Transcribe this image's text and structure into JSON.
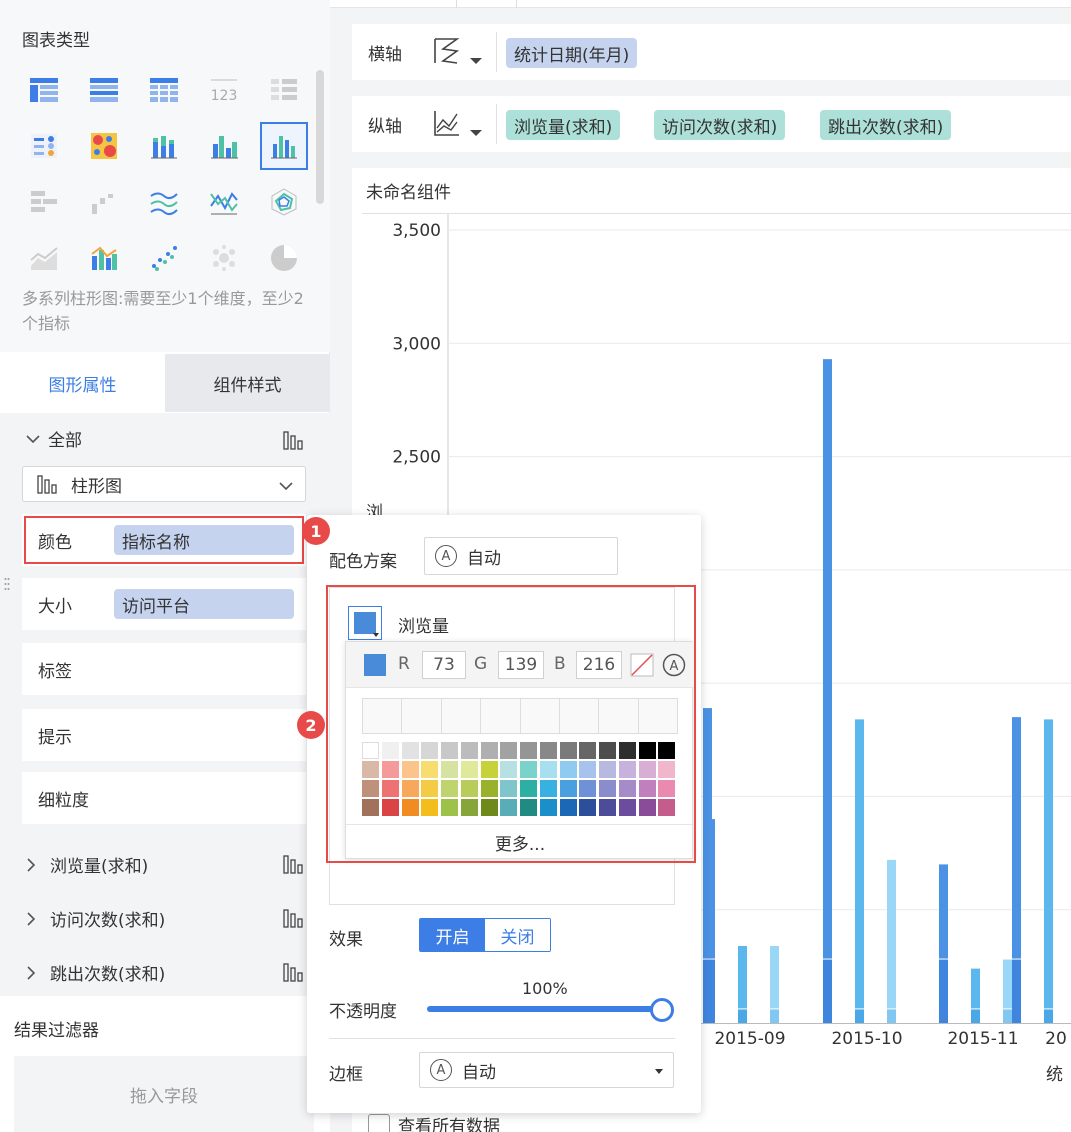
{
  "left_panel": {
    "chart_types_title": "图表类型",
    "chart_desc": "多系列柱形图:需要至少1个维度，至少2个指标",
    "tabs": [
      {
        "label": "图形属性",
        "active": true
      },
      {
        "label": "组件样式",
        "active": false
      }
    ],
    "section_all": "全部",
    "chart_kind_select": "柱形图",
    "props": {
      "color": {
        "label": "颜色",
        "value": "指标名称"
      },
      "size": {
        "label": "大小",
        "value": "访问平台"
      },
      "label": "标签",
      "tooltip": "提示",
      "granularity": "细粒度"
    },
    "measures": [
      "浏览量(求和)",
      "访问次数(求和)",
      "跳出次数(求和)"
    ],
    "filter_title": "结果过滤器",
    "drop_field": "拖入字段"
  },
  "axes": {
    "x": {
      "label": "横轴",
      "fields": [
        "统计日期(年月)"
      ]
    },
    "y": {
      "label": "纵轴",
      "fields": [
        "浏览量(求和)",
        "访问次数(求和)",
        "跳出次数(求和)"
      ]
    }
  },
  "chart": {
    "title": "未命名组件",
    "y_axis_label_partial": "浏",
    "x_axis_label_partial": "统",
    "view_all": "查看所有数据"
  },
  "chart_data": {
    "type": "bar",
    "ylim": [
      0,
      3500
    ],
    "y_ticks": [
      "3,500",
      "3,000",
      "2,500"
    ],
    "categories": [
      "2015-09",
      "2015-10",
      "2015-11",
      "20"
    ],
    "series": [
      {
        "name": "浏览量",
        "values": [
          900,
          2930,
          700,
          1350
        ]
      },
      {
        "name": "访问次数",
        "values": [
          340,
          1340,
          240,
          1340
        ]
      },
      {
        "name": "跳出次数",
        "values": [
          340,
          720,
          280,
          0
        ]
      }
    ]
  },
  "popup": {
    "scheme_label": "配色方案",
    "scheme_value": "自动",
    "series_name": "浏览量",
    "rgb": {
      "r_label": "R",
      "r": "73",
      "g_label": "G",
      "g": "139",
      "b_label": "B",
      "b": "216"
    },
    "more": "更多...",
    "effect_label": "效果",
    "effect_on": "开启",
    "effect_off": "关闭",
    "opacity_label": "不透明度",
    "opacity_value": "100%",
    "opacity": 1.0,
    "border_label": "边框",
    "border_value": "自动"
  },
  "badges": [
    "1",
    "2"
  ],
  "colors": {
    "accent": "#3d7ee6",
    "selected_color": "#498bd8",
    "highlight": "#e84a4a"
  }
}
